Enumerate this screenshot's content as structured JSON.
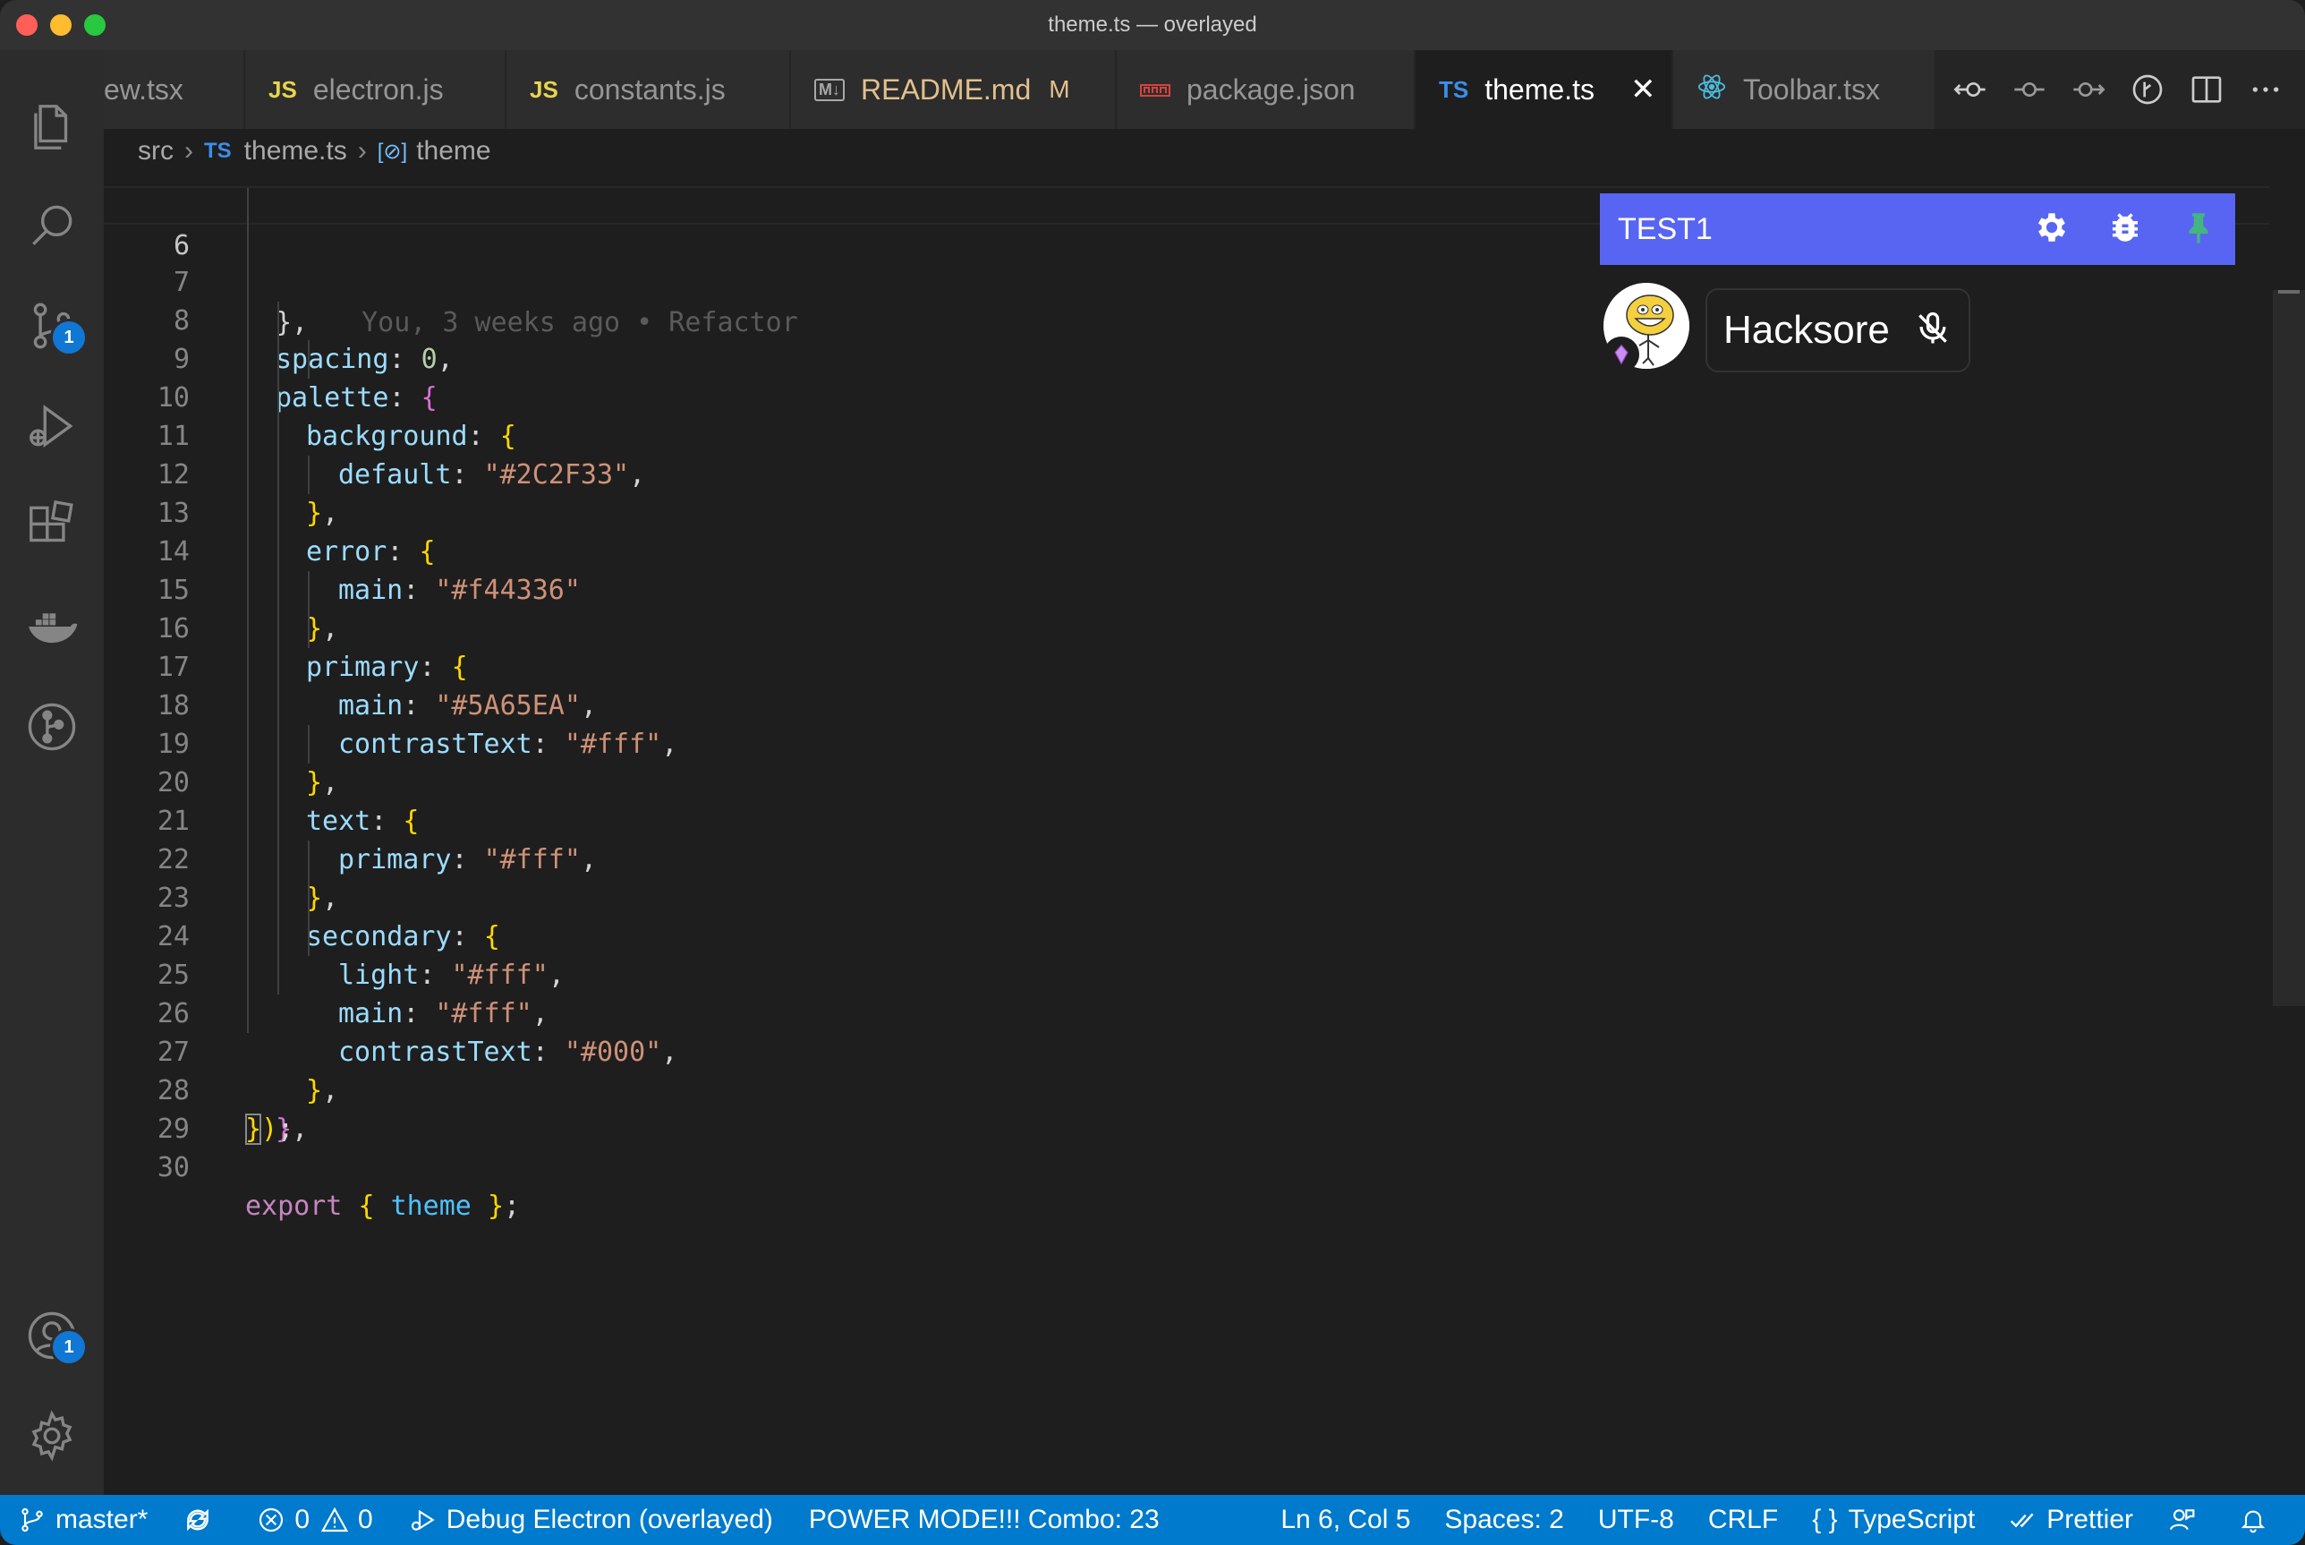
{
  "window": {
    "title": "theme.ts — overlayed"
  },
  "activity_bar": {
    "source_control_badge": "1",
    "accounts_badge": "1"
  },
  "tabs": [
    {
      "label": "ew.tsx",
      "icon": "",
      "active": false
    },
    {
      "label": "electron.js",
      "icon": "JS",
      "active": false
    },
    {
      "label": "constants.js",
      "icon": "JS",
      "active": false
    },
    {
      "label": "README.md",
      "icon": "M↓",
      "active": false,
      "modified_marker": "M"
    },
    {
      "label": "package.json",
      "icon": "json-icon",
      "active": false
    },
    {
      "label": "theme.ts",
      "icon": "TS",
      "active": true
    },
    {
      "label": "Toolbar.tsx",
      "icon": "react-icon",
      "active": false
    }
  ],
  "breadcrumb": {
    "folder": "src",
    "file_icon": "TS",
    "file": "theme.ts",
    "symbol": "theme"
  },
  "editor": {
    "current_line": 6,
    "blame": "You, 3 weeks ago • Refactor",
    "line_numbers": [
      "6",
      "7",
      "8",
      "9",
      "10",
      "11",
      "12",
      "13",
      "14",
      "15",
      "16",
      "17",
      "18",
      "19",
      "20",
      "21",
      "22",
      "23",
      "24",
      "25",
      "26",
      "27",
      "28",
      "29",
      "30"
    ],
    "code": {
      "l6": "},",
      "l7k": "spacing",
      "l7v": "0",
      "l8k": "palette",
      "l9k": "background",
      "l10k": "default",
      "l10v": "\"#2C2F33\"",
      "l12k": "error",
      "l13k": "main",
      "l13v": "\"#f44336\"",
      "l15k": "primary",
      "l16k": "main",
      "l16v": "\"#5A65EA\"",
      "l17k": "contrastText",
      "l17v": "\"#fff\"",
      "l19k": "text",
      "l20k": "primary",
      "l20v": "\"#fff\"",
      "l22k": "secondary",
      "l23k": "light",
      "l23v": "\"#fff\"",
      "l24k": "main",
      "l24v": "\"#fff\"",
      "l25k": "contrastText",
      "l25v": "\"#000\"",
      "l30kw": "export",
      "l30id": "theme"
    }
  },
  "overlay": {
    "title": "TEST1",
    "user_name": "Hacksore",
    "header_color": "#5865f2",
    "pin_color": "#43b581"
  },
  "status_bar": {
    "branch": "master*",
    "errors": "0",
    "warnings": "0",
    "debug": "Debug Electron (overlayed)",
    "power_mode": "POWER MODE!!! Combo: 23",
    "position": "Ln 6, Col 5",
    "spaces": "Spaces: 2",
    "encoding": "UTF-8",
    "eol": "CRLF",
    "language": "TypeScript",
    "formatter": "Prettier",
    "background": "#007acc"
  }
}
